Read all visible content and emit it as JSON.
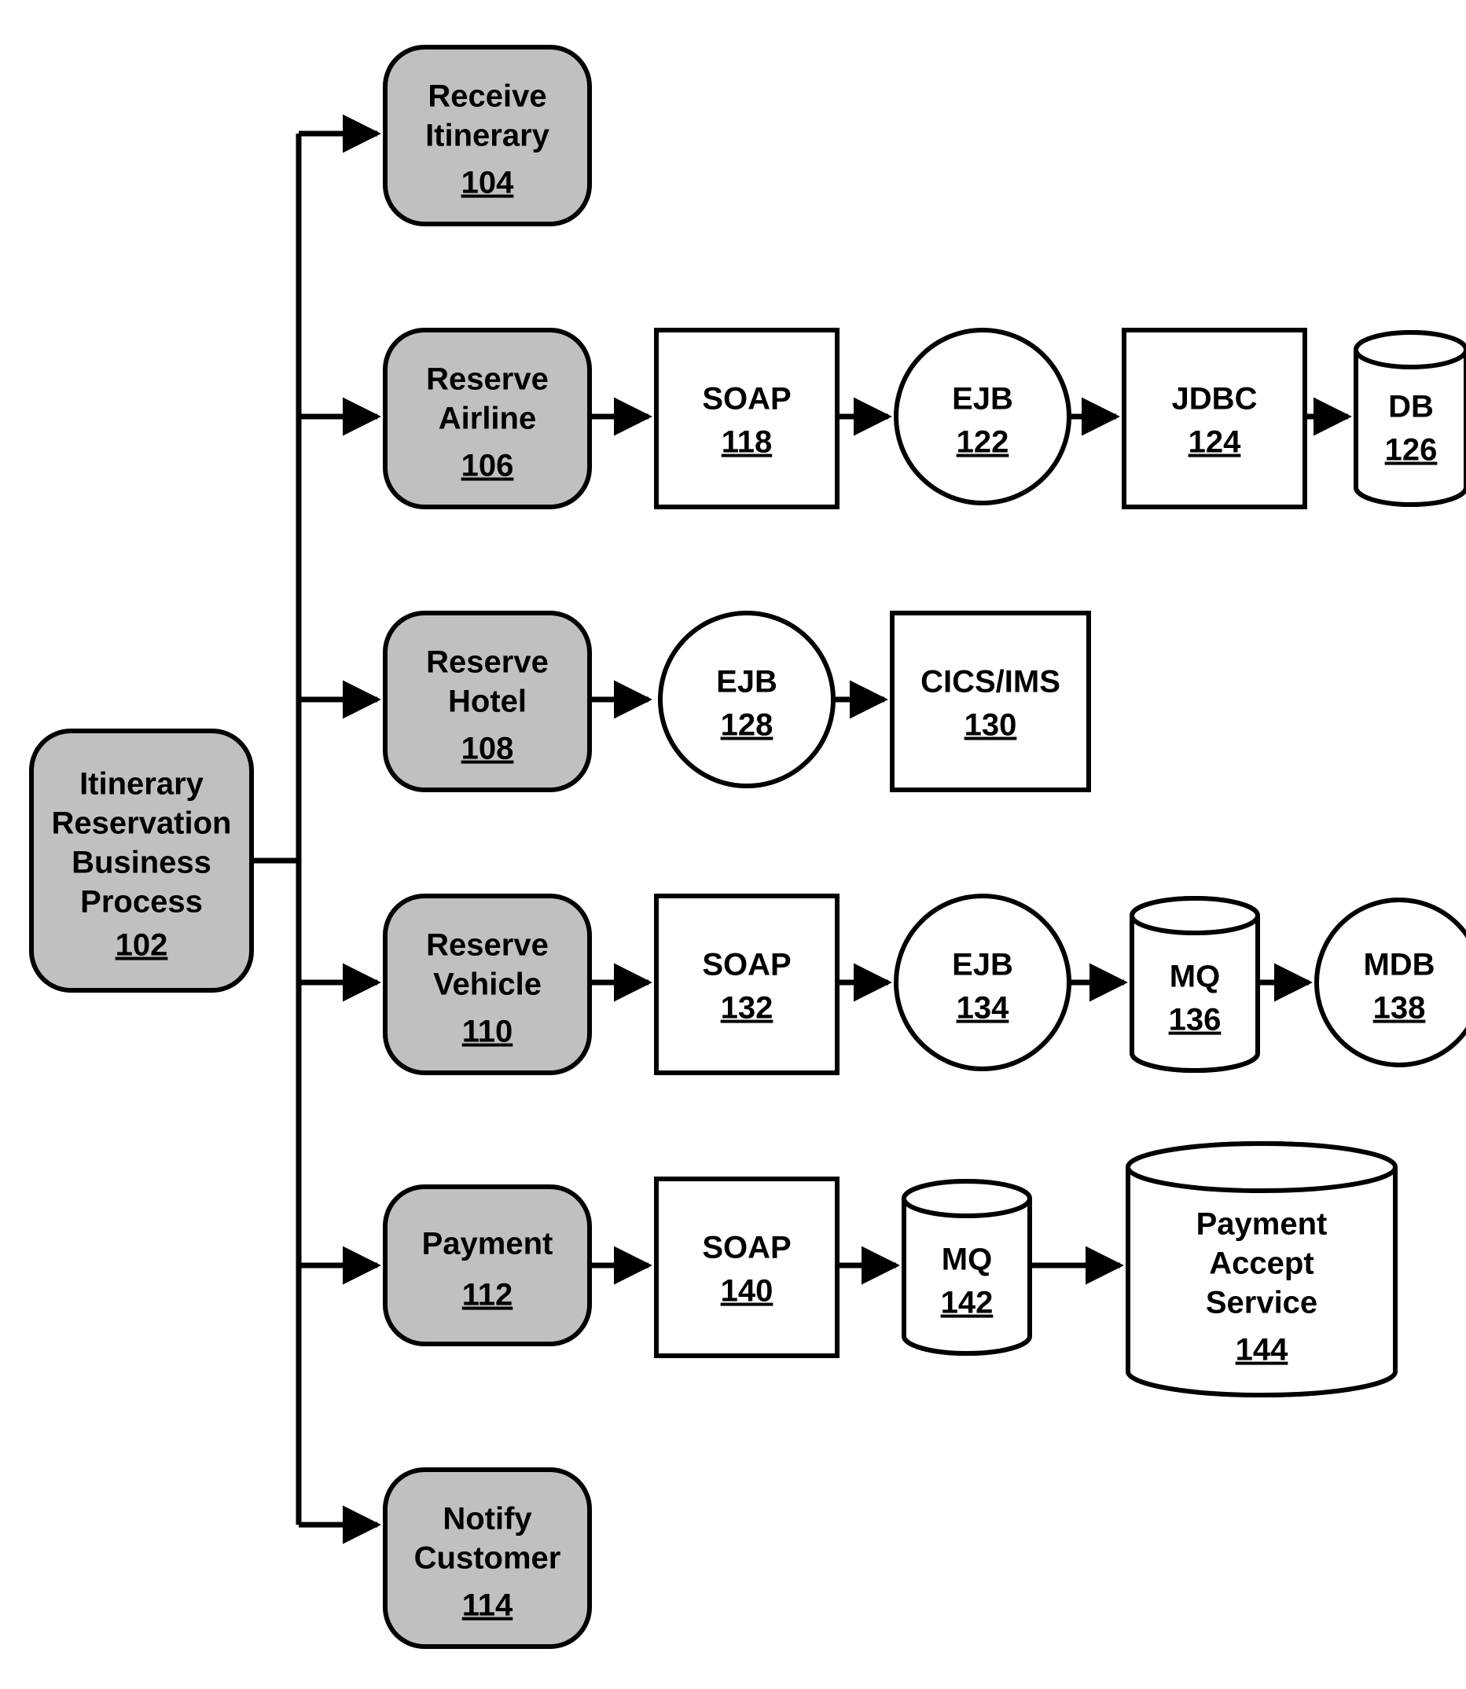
{
  "root": {
    "l1": "Itinerary",
    "l2": "Reservation",
    "l3": "Business",
    "l4": "Process",
    "num": "102"
  },
  "steps": {
    "receive": {
      "l1": "Receive",
      "l2": "Itinerary",
      "num": "104"
    },
    "airline": {
      "l1": "Reserve",
      "l2": "Airline",
      "num": "106"
    },
    "hotel": {
      "l1": "Reserve",
      "l2": "Hotel",
      "num": "108"
    },
    "vehicle": {
      "l1": "Reserve",
      "l2": "Vehicle",
      "num": "110"
    },
    "payment": {
      "l1": "Payment",
      "num": "112"
    },
    "notify": {
      "l1": "Notify",
      "l2": "Customer",
      "num": "114"
    }
  },
  "n118": {
    "label": "SOAP",
    "num": "118"
  },
  "n122": {
    "label": "EJB",
    "num": "122"
  },
  "n124": {
    "label": "JDBC",
    "num": "124"
  },
  "n126": {
    "label": "DB",
    "num": "126"
  },
  "n128": {
    "label": "EJB",
    "num": "128"
  },
  "n130": {
    "label": "CICS/IMS",
    "num": "130"
  },
  "n132": {
    "label": "SOAP",
    "num": "132"
  },
  "n134": {
    "label": "EJB",
    "num": "134"
  },
  "n136": {
    "label": "MQ",
    "num": "136"
  },
  "n138": {
    "label": "MDB",
    "num": "138"
  },
  "n140": {
    "label": "SOAP",
    "num": "140"
  },
  "n142": {
    "label": "MQ",
    "num": "142"
  },
  "n144": {
    "l1": "Payment",
    "l2": "Accept",
    "l3": "Service",
    "num": "144"
  }
}
